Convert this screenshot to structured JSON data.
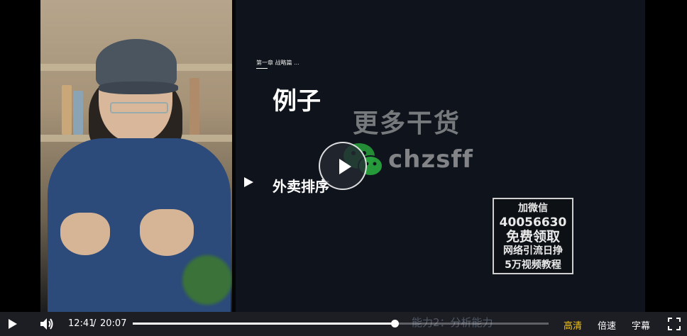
{
  "slide": {
    "breadcrumb": "第一章 战略篇 ...",
    "title": "例子",
    "bullet": "外卖排序"
  },
  "watermark": {
    "headline": "更多干货",
    "handle": "chzsff",
    "promo_lines": [
      "加微信",
      "40056630",
      "免费领取",
      "网络引流日挣",
      "5万视频教程"
    ]
  },
  "ghost_text": "能力2：分析能力",
  "player": {
    "current_time": "12:41",
    "separator": "/",
    "duration": "20:07",
    "progress": 0.63,
    "quality_label": "高清",
    "speed_label": "倍速",
    "subtitle_label": "字幕",
    "accent_color": "#f5c518"
  }
}
